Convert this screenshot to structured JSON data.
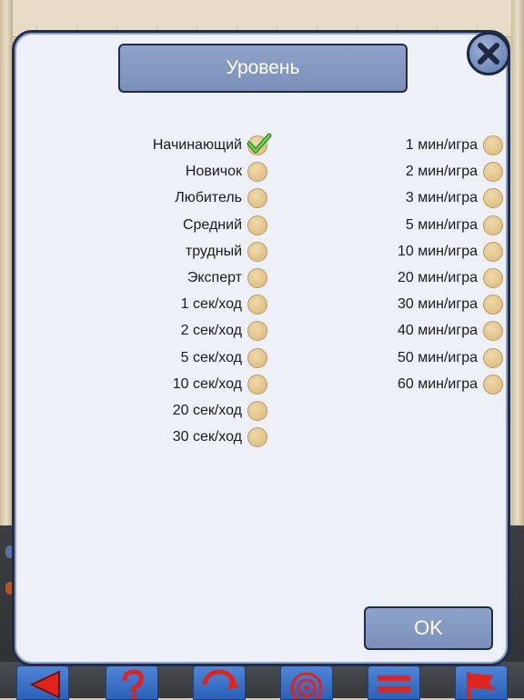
{
  "dialog": {
    "title": "Уровень",
    "ok_label": "OK",
    "close_icon": "close-icon",
    "left_options": [
      {
        "label": "Начинающий",
        "selected": true
      },
      {
        "label": "Новичок",
        "selected": false
      },
      {
        "label": "Любитель",
        "selected": false
      },
      {
        "label": "Средний",
        "selected": false
      },
      {
        "label": "трудный",
        "selected": false
      },
      {
        "label": "Эксперт",
        "selected": false
      },
      {
        "label": "1 сек/ход",
        "selected": false
      },
      {
        "label": "2 сек/ход",
        "selected": false
      },
      {
        "label": "5 сек/ход",
        "selected": false
      },
      {
        "label": "10 сек/ход",
        "selected": false
      },
      {
        "label": "20 сек/ход",
        "selected": false
      },
      {
        "label": "30 сек/ход",
        "selected": false
      }
    ],
    "right_options": [
      {
        "label": "1 мин/игра",
        "selected": false
      },
      {
        "label": "2 мин/игра",
        "selected": false
      },
      {
        "label": "3 мин/игра",
        "selected": false
      },
      {
        "label": "5 мин/игра",
        "selected": false
      },
      {
        "label": "10 мин/игра",
        "selected": false
      },
      {
        "label": "20 мин/игра",
        "selected": false
      },
      {
        "label": "30 мин/игра",
        "selected": false
      },
      {
        "label": "40 мин/игра",
        "selected": false
      },
      {
        "label": "50 мин/игра",
        "selected": false
      },
      {
        "label": "60 мин/игра",
        "selected": false
      }
    ]
  },
  "colors": {
    "dialog_bg": "#eef0f7",
    "button_bg": "#8ea3c8",
    "radio": "#e3c48c",
    "check": "#3fae2a"
  },
  "toolbar_icons": [
    "arrow-left-icon",
    "help-icon",
    "rotate-icon",
    "target-icon",
    "menu-icon",
    "flag-icon"
  ]
}
